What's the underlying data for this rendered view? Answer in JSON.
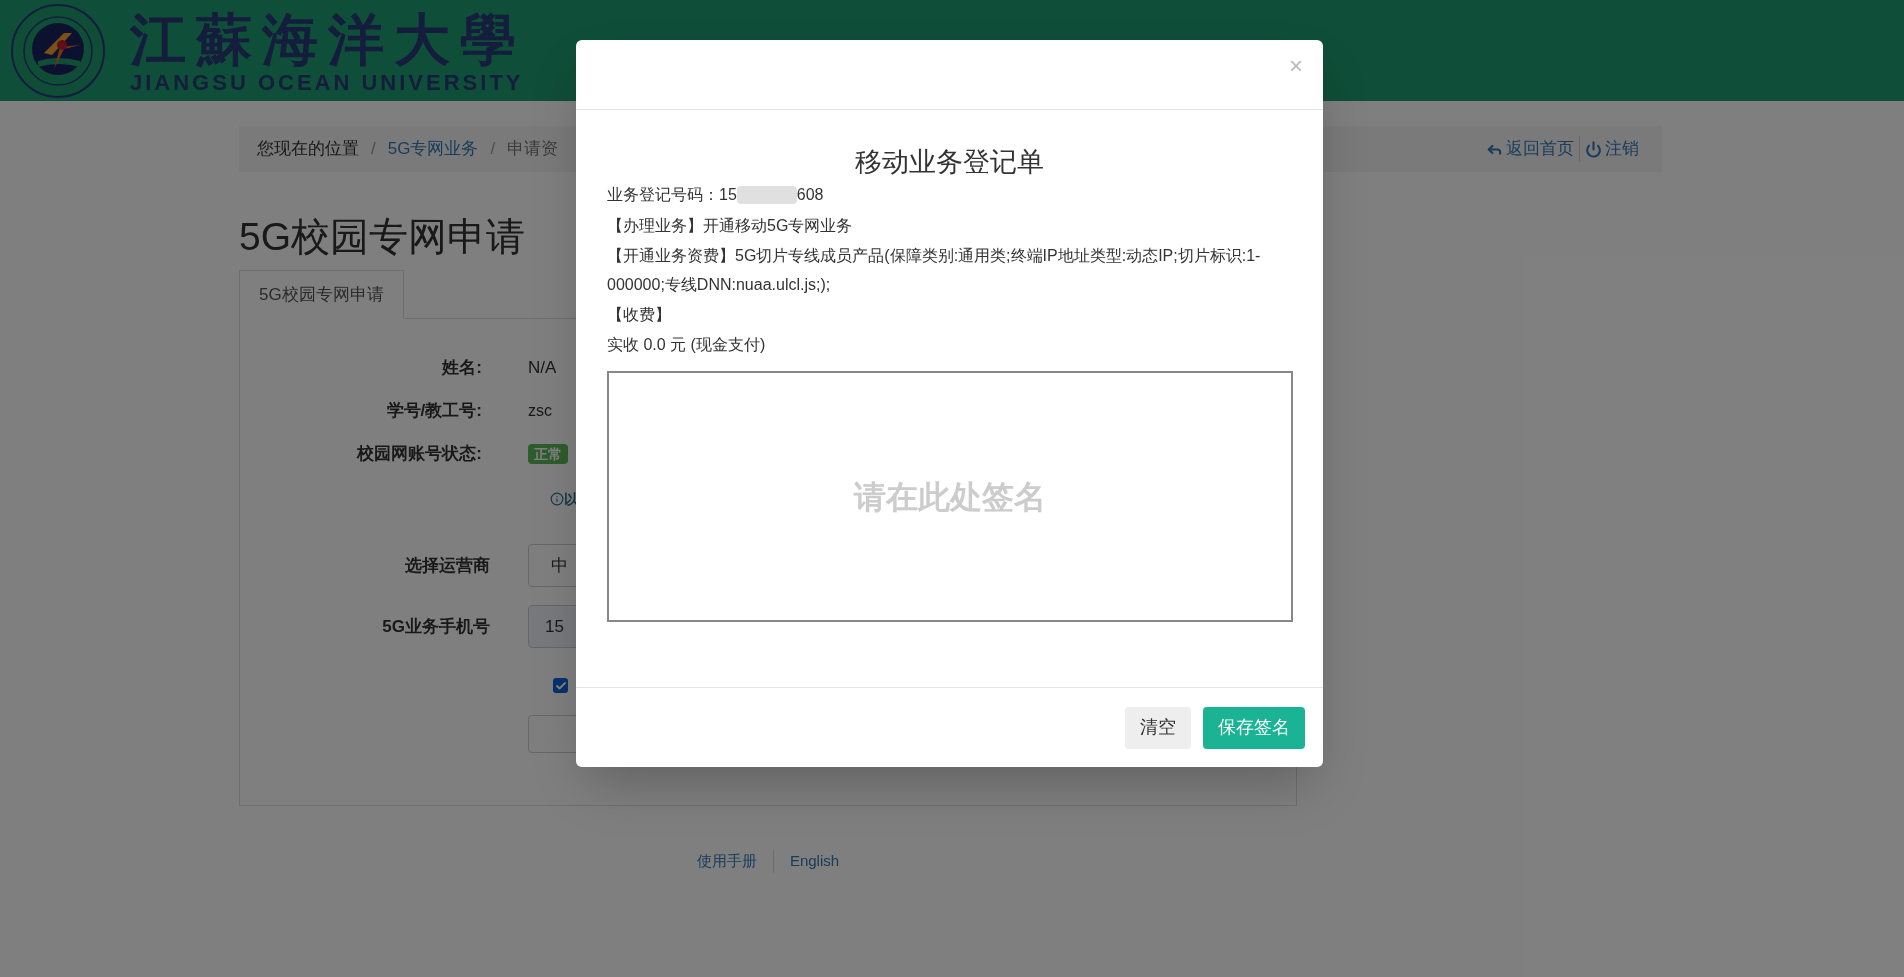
{
  "header": {
    "title_cn": "江蘇海洋大學",
    "title_en": "JIANGSU OCEAN UNIVERSITY"
  },
  "breadcrumb": {
    "separator": "/",
    "items": [
      {
        "label": "您现在的位置",
        "kind": "text"
      },
      {
        "label": "5G专网业务",
        "kind": "link"
      },
      {
        "label": "申请资",
        "kind": "text"
      }
    ],
    "actions": [
      {
        "label": "返回首页",
        "kind": "home"
      },
      {
        "label": "注销",
        "kind": "logout"
      }
    ]
  },
  "page_title": "5G校园专网申请",
  "tabs": [
    {
      "label": "5G校园专网申请",
      "selected": true
    }
  ],
  "form": {
    "rows": [
      {
        "label": "姓名:",
        "value": "N/A",
        "kind": "text"
      },
      {
        "label": "学号/教工号:",
        "value": "zsc",
        "kind": "small"
      },
      {
        "label": "校园网账号状态:",
        "value": "正常",
        "kind": "badge"
      }
    ],
    "info": "以",
    "operator": {
      "label": "选择运营商",
      "value": "中"
    },
    "phone": {
      "label": "5G业务手机号",
      "value": "15"
    },
    "agree": {
      "checked": true
    }
  },
  "footer": {
    "links": [
      "使用手册",
      "English"
    ]
  },
  "modal": {
    "close": "×",
    "title": "移动业务登记单",
    "number": {
      "label": "业务登记号码：",
      "prefix": "15",
      "suffix": "608"
    },
    "lines": [
      "【办理业务】开通移动5G专网业务",
      "【开通业务资费】5G切片专线成员产品(保障类别:通用类;终端IP地址类型:动态IP;切片标识:1-000000;专线DNN:nuaa.ulcl.js;);",
      "【收费】",
      "实收 0.0 元 (现金支付)"
    ],
    "signature_placeholder": "请在此处签名",
    "buttons": [
      {
        "label": "清空",
        "kind": "default"
      },
      {
        "label": "保存签名",
        "kind": "primary"
      }
    ]
  }
}
